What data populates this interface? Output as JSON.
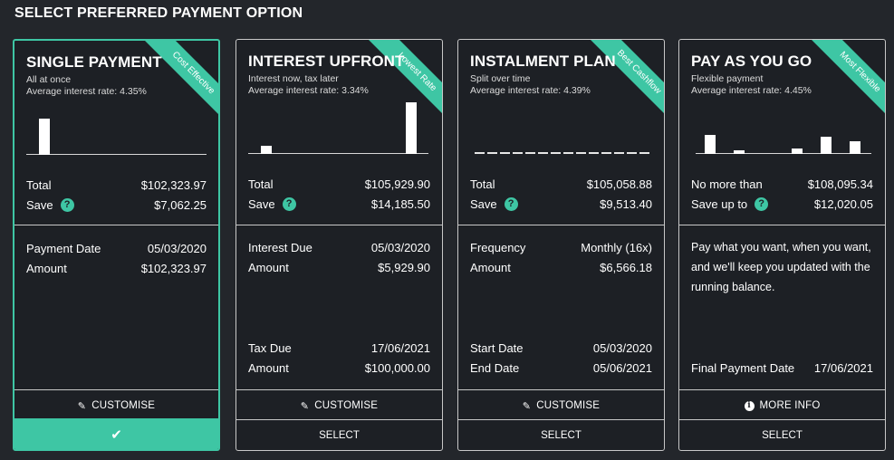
{
  "page": {
    "title": "SELECT PREFERRED PAYMENT OPTION"
  },
  "cards": [
    {
      "title": "SINGLE PAYMENT",
      "subtitle": "All at once",
      "rate": "Average interest rate: 4.35%",
      "ribbon": "Cost Effective",
      "summary": {
        "total_label": "Total",
        "total_value": "$102,323.97",
        "save_label": "Save",
        "save_value": "$7,062.25"
      },
      "details": [
        {
          "label": "Payment Date",
          "value": "05/03/2020"
        },
        {
          "label": "Amount",
          "value": "$102,323.97"
        }
      ],
      "footer_label": "CUSTOMISE",
      "select_label": "✔",
      "selected": true
    },
    {
      "title": "INTEREST UPFRONT",
      "subtitle": "Interest now, tax later",
      "rate": "Average interest rate: 3.34%",
      "ribbon": "Lowest Rate",
      "summary": {
        "total_label": "Total",
        "total_value": "$105,929.90",
        "save_label": "Save",
        "save_value": "$14,185.50"
      },
      "details": [
        {
          "label": "Interest Due",
          "value": "05/03/2020"
        },
        {
          "label": "Amount",
          "value": "$5,929.90"
        }
      ],
      "details2": [
        {
          "label": "Tax Due",
          "value": "17/06/2021"
        },
        {
          "label": "Amount",
          "value": "$100,000.00"
        }
      ],
      "footer_label": "CUSTOMISE",
      "select_label": "SELECT",
      "selected": false
    },
    {
      "title": "INSTALMENT PLAN",
      "subtitle": "Split over time",
      "rate": "Average interest rate: 4.39%",
      "ribbon": "Best Cashflow",
      "summary": {
        "total_label": "Total",
        "total_value": "$105,058.88",
        "save_label": "Save",
        "save_value": "$9,513.40"
      },
      "details": [
        {
          "label": "Frequency",
          "value": "Monthly (16x)"
        },
        {
          "label": "Amount",
          "value": "$6,566.18"
        }
      ],
      "details2": [
        {
          "label": "Start Date",
          "value": "05/03/2020"
        },
        {
          "label": "End Date",
          "value": "05/06/2021"
        }
      ],
      "footer_label": "CUSTOMISE",
      "select_label": "SELECT",
      "selected": false
    },
    {
      "title": "PAY AS YOU GO",
      "subtitle": "Flexible payment",
      "rate": "Average interest rate: 4.45%",
      "ribbon": "Most Flexible",
      "summary": {
        "total_label": "No more than",
        "total_value": "$108,095.34",
        "save_label": "Save up to",
        "save_value": "$12,020.05"
      },
      "description": "Pay what you want, when you want, and we'll keep you updated with the running balance.",
      "details2": [
        {
          "label": "Final Payment Date",
          "value": "17/06/2021"
        }
      ],
      "footer_label": "MORE INFO",
      "select_label": "SELECT",
      "selected": false
    }
  ],
  "colors": {
    "accent": "#3ec6a4",
    "background": "#23262b",
    "card": "#1d2025",
    "border": "#c8c8c8"
  },
  "icons": {
    "customise": "edit-icon",
    "info": "info-icon",
    "help": "question-icon",
    "select": "check-icon"
  }
}
